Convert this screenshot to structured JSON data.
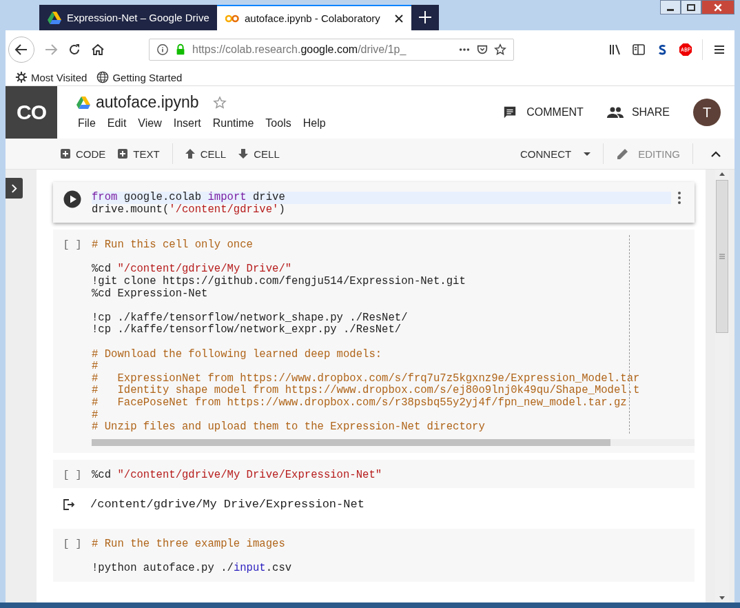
{
  "browser": {
    "tabs": [
      {
        "title": "Expression-Net – Google Drive",
        "selected": false
      },
      {
        "title": "autoface.ipynb - Colaboratory",
        "selected": true
      }
    ],
    "url": {
      "prefix": "https://colab.research.",
      "domain": "google.com",
      "path": "/drive/1p_"
    },
    "bookmarks": [
      {
        "label": "Most Visited"
      },
      {
        "label": "Getting Started"
      }
    ]
  },
  "colab": {
    "logo": "CO",
    "title": "autoface.ipynb",
    "menu": [
      "File",
      "Edit",
      "View",
      "Insert",
      "Runtime",
      "Tools",
      "Help"
    ],
    "actions": [
      {
        "label": "COMMENT"
      },
      {
        "label": "SHARE"
      }
    ],
    "avatar": "T",
    "toolbar_left": [
      {
        "label": "CODE"
      },
      {
        "label": "TEXT"
      },
      {
        "label": "CELL"
      },
      {
        "label": "CELL"
      }
    ],
    "connect": "CONNECT",
    "editing": "EDITING"
  },
  "cells": [
    {
      "kind": "active",
      "blocks": [
        [
          [
            {
              "kind": "kw",
              "s": "from"
            },
            {
              "kind": "plain",
              "s": " google.colab "
            },
            {
              "kind": "kw",
              "s": "import"
            },
            {
              "kind": "plain",
              "s": " drive"
            }
          ],
          [
            {
              "kind": "plain",
              "s": "drive.mount("
            },
            {
              "kind": "str",
              "s": "'/content/gdrive'"
            },
            {
              "kind": "plain",
              "s": ")"
            }
          ]
        ]
      ]
    },
    {
      "kind": "idle",
      "prompt": "[ ]",
      "ruler": true,
      "scrollbar": true,
      "blocks": [
        [
          [
            {
              "kind": "comment",
              "s": "# Run this cell only once"
            }
          ]
        ],
        [
          [
            {
              "kind": "plain",
              "s": "%cd "
            },
            {
              "kind": "str",
              "s": "\"/content/gdrive/My Drive/\""
            }
          ],
          [
            {
              "kind": "plain",
              "s": "!git clone https://github.com/fengju514/Expression-Net.git"
            }
          ],
          [
            {
              "kind": "plain",
              "s": "%cd Expression-Net"
            }
          ]
        ],
        [
          [
            {
              "kind": "plain",
              "s": "!cp ./kaffe/tensorflow/network_shape.py ./ResNet/"
            }
          ],
          [
            {
              "kind": "plain",
              "s": "!cp ./kaffe/tensorflow/network_expr.py ./ResNet/"
            }
          ]
        ],
        [
          [
            {
              "kind": "comment",
              "s": "# Download the following learned deep models:"
            }
          ],
          [
            {
              "kind": "comment",
              "s": "#"
            }
          ],
          [
            {
              "kind": "comment",
              "s": "#   ExpressionNet from https://www.dropbox.com/s/frq7u7z5kgxnz9e/Expression_Model.tar"
            }
          ],
          [
            {
              "kind": "comment",
              "s": "#   Identity shape model from https://www.dropbox.com/s/ej80o9lnj0k49qu/Shape_Model.t"
            }
          ],
          [
            {
              "kind": "comment",
              "s": "#   FacePoseNet from https://www.dropbox.com/s/r38psbq55y2yj4f/fpn_new_model.tar.gz"
            }
          ],
          [
            {
              "kind": "comment",
              "s": "#"
            }
          ],
          [
            {
              "kind": "comment",
              "s": "# Unzip files and upload them to the Expression-Net directory"
            }
          ]
        ]
      ]
    },
    {
      "kind": "idle",
      "prompt": "[ ]",
      "blocks": [
        [
          [
            {
              "kind": "plain",
              "s": "%cd "
            },
            {
              "kind": "str",
              "s": "\"/content/gdrive/My Drive/Expression-Net\""
            }
          ]
        ]
      ],
      "output": "/content/gdrive/My Drive/Expression-Net"
    },
    {
      "kind": "idle",
      "prompt": "[ ]",
      "blocks": [
        [
          [
            {
              "kind": "comment",
              "s": "# Run the three example images"
            }
          ]
        ],
        [
          [
            {
              "kind": "plain",
              "s": "!python autoface.py ./"
            },
            {
              "kind": "builtin",
              "s": "input"
            },
            {
              "kind": "plain",
              "s": ".csv"
            }
          ]
        ]
      ]
    }
  ]
}
